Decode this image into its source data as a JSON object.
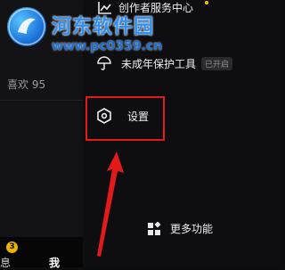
{
  "profile": {
    "likes_label": "喜欢 95"
  },
  "menu": {
    "creator_center": "创作者服务中心",
    "minor_protection": "未成年保护工具",
    "minor_status_tag": "已开启",
    "settings": "设置",
    "more_features": "更多功能"
  },
  "bottom_nav": {
    "messages_label": "息",
    "messages_badge": "3",
    "me_label": "我"
  },
  "watermark": {
    "title": "河东软件园",
    "url": "www.pc0359.cn"
  },
  "colors": {
    "highlight": "#e41a1a",
    "badge": "#e8b400",
    "notify_dot": "#f4c20d"
  },
  "icons": {
    "creator_center": "chart-icon",
    "minor_protection": "umbrella-icon",
    "settings": "hexagon-gear-icon",
    "more_features": "grid-icon",
    "annotation": "red-arrow-icon"
  }
}
